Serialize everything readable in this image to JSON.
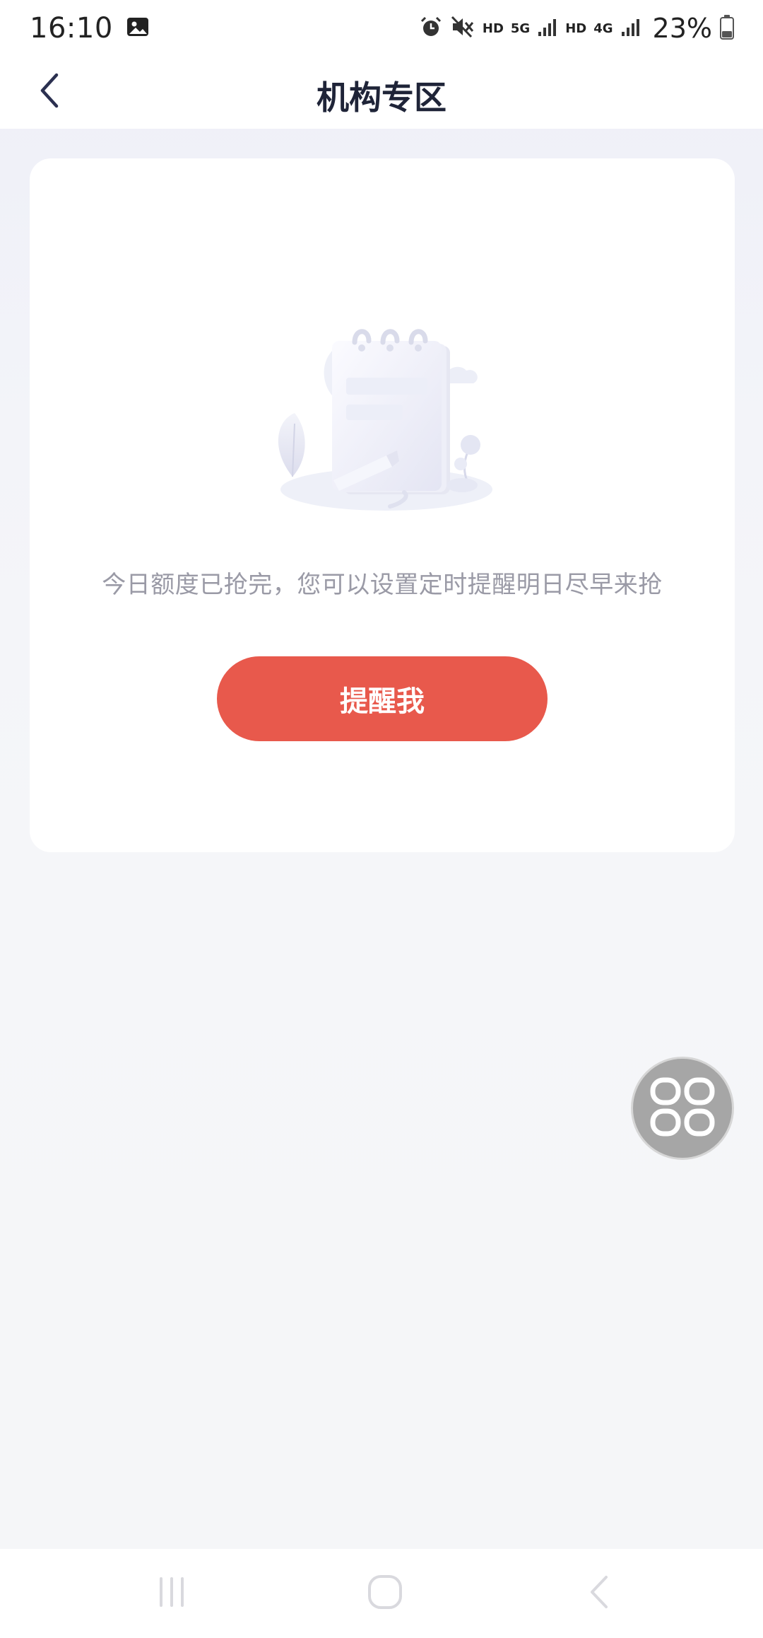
{
  "status_bar": {
    "time": "16:10",
    "hd1": "HD",
    "network1": "5G",
    "hd2": "HD",
    "network2": "4G",
    "battery": "23%"
  },
  "header": {
    "title": "机构专区"
  },
  "card": {
    "message": "今日额度已抢完，您可以设置定时提醒明日尽早来抢",
    "button_label": "提醒我"
  },
  "colors": {
    "accent": "#e8594c",
    "title": "#1f2438",
    "muted_text": "#9a9aa6"
  },
  "icons": {
    "back": "chevron-left-icon",
    "float": "grid-apps-icon",
    "status": [
      "image-icon",
      "alarm-icon",
      "mute-icon",
      "signal-icon",
      "battery-icon"
    ],
    "nav": [
      "recent-apps-icon",
      "home-icon",
      "back-icon"
    ]
  }
}
